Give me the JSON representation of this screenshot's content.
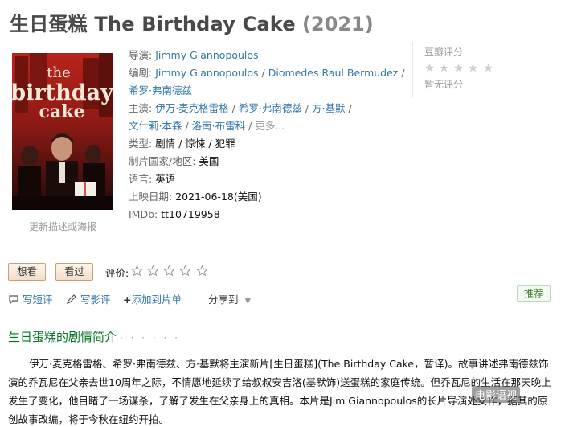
{
  "title": {
    "name": "生日蛋糕 The Birthday Cake",
    "year": "(2021)"
  },
  "poster": {
    "title_line1": "the",
    "title_line2": "birthday",
    "title_line3": "cake",
    "caption": "更新描述或海报"
  },
  "info": {
    "director_label": "导演:",
    "director": "Jimmy Giannopoulos",
    "writer_label": "编剧:",
    "writers": [
      "Jimmy Giannopoulos",
      "Diomedes Raul Bermudez",
      "希罗·弗南德兹"
    ],
    "cast_label": "主演:",
    "cast": [
      "伊万·麦克格雷格",
      "希罗·弗南德兹",
      "方·基默",
      "文什莉·本森",
      "洛南·布雷科"
    ],
    "cast_more": "更多...",
    "genre_label": "类型:",
    "genres": [
      "剧情",
      "惊悚",
      "犯罪"
    ],
    "country_label": "制片国家/地区:",
    "country": "美国",
    "language_label": "语言:",
    "language": "英语",
    "release_label": "上映日期:",
    "release": "2021-06-18(美国)",
    "imdb_label": "IMDb:",
    "imdb": "tt10719958"
  },
  "rating": {
    "title": "豆瓣评分",
    "no_rating": "暂无评分",
    "stars_filled": 0,
    "stars_total": 5
  },
  "user_actions": {
    "want_label": "想看",
    "seen_label": "看过",
    "rate_label": "评价:",
    "short_review": "写短评",
    "review": "写影评",
    "add_list": "添加到片单",
    "share": "分享到",
    "recommend": "推荐"
  },
  "synopsis": {
    "heading": "生日蛋糕的剧情简介",
    "heading_dots": "· · · · · ·",
    "text": "伊万·麦克格雷格、希罗·弗南德兹、方·基默将主演新片[生日蛋糕](The Birthday Cake，暂译)。故事讲述弗南德兹饰演的乔瓦尼在父亲去世10周年之际，不情愿地延续了给叔叔安吉洛(基默饰)送蛋糕的家庭传统。但乔瓦尼的生活在那天晚上发生了变化，他目睹了一场谋杀，了解了发生在父亲身上的真相。本片是Jim Giannopoulos的长片导演处女作，据其的原创故事改编，将于今秋在纽约开拍。"
  },
  "watermark": "电影语视",
  "colors": {
    "link": "#3377aa",
    "green_heading": "#007722",
    "star_empty": "#d0d0d0"
  },
  "icons": [
    "short-review-icon",
    "pen-icon",
    "plus-icon",
    "chevron-down-icon",
    "star-icon"
  ]
}
